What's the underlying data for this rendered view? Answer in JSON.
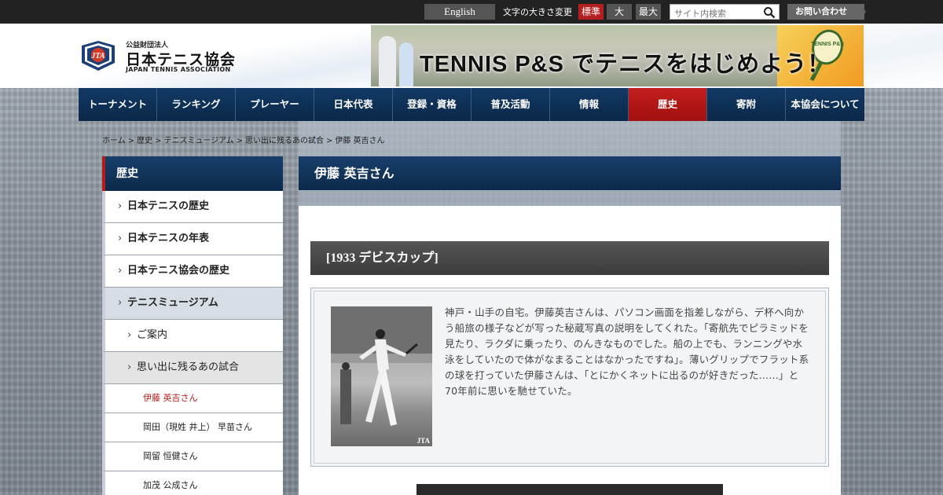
{
  "topbar": {
    "english": "English",
    "font_size_label": "文字の大きさ変更",
    "font_sizes": [
      "標準",
      "大",
      "最大"
    ],
    "search_placeholder": "サイト内検索",
    "contact": "お問い合わせ"
  },
  "logo": {
    "sub": "公益財団法人",
    "main": "日本テニス協会",
    "en": "JAPAN TENNIS ASSOCIATION",
    "mark": "JTA"
  },
  "banner": {
    "text": "TENNIS P&S でテニスをはじめよう！",
    "racket_text": "TENNIS P&S"
  },
  "nav": [
    "トーナメント",
    "ランキング",
    "プレーヤー",
    "日本代表",
    "登録・資格",
    "普及活動",
    "情報",
    "歴史",
    "寄附",
    "本協会について"
  ],
  "breadcrumb": [
    "ホーム",
    "歴史",
    "テニスミュージアム",
    "思い出に残るあの試合",
    "伊藤 英吉さん"
  ],
  "sidebar": {
    "head": "歴史",
    "items": [
      "日本テニスの歴史",
      "日本テニスの年表",
      "日本テニス協会の歴史",
      "テニスミュージアム",
      "ご案内",
      "思い出に残るあの試合",
      "伊藤 英吉さん",
      "岡田（現姓 井上） 早苗さん",
      "岡留 恒健さん",
      "加茂 公成さん"
    ]
  },
  "main": {
    "title": "伊藤 英吉さん",
    "subtitle": "[1933 デビスカップ]",
    "photo_watermark": "JTA",
    "description": "神戸・山手の自宅。伊藤英吉さんは、パソコン画面を指差しながら、デ杯へ向かう船旅の様子などが写った秘蔵写真の説明をしてくれた。「寄航先でピラミッドを見たり、ラクダに乗ったり、のんきなものでした。船の上でも、ランニングや水泳をしていたので体がなまることはなかったですね」。薄いグリップでフラット系の球を打っていた伊藤さんは、「とにかくネットに出るのが好きだった……」と70年前に思いを馳せていた。"
  },
  "colors": {
    "nav": "#0e2f55",
    "accent": "#b51e1e",
    "subbar": "#444444"
  }
}
